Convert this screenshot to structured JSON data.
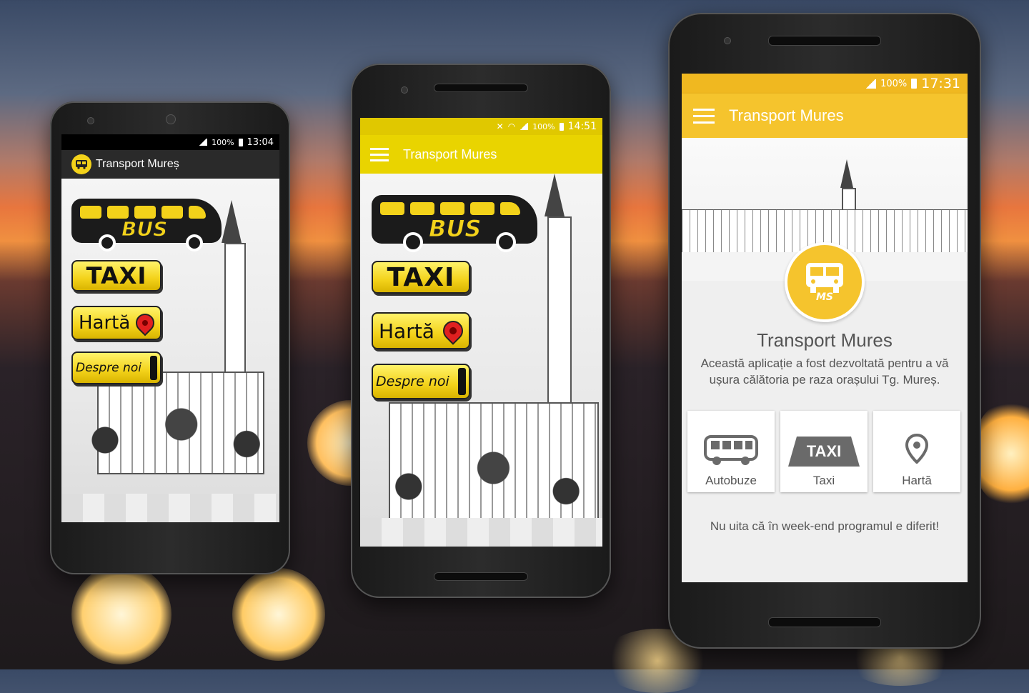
{
  "phone1": {
    "status": {
      "battery": "100%",
      "time": "13:04"
    },
    "app_title": "Transport Mureș",
    "bus_word": "BUS",
    "taxi_label": "TAXI",
    "map_label": "Hartă",
    "about_label": "Despre noi"
  },
  "phone2": {
    "status": {
      "battery": "100%",
      "time": "14:51"
    },
    "app_title": "Transport Mures",
    "bus_word": "BUS",
    "taxi_label": "TAXI",
    "map_label": "Hartă",
    "about_label": "Despre noi"
  },
  "phone3": {
    "status": {
      "battery": "100%",
      "time": "17:31"
    },
    "app_title": "Transport Mures",
    "logo_text": "MS",
    "heading": "Transport Mures",
    "description": "Această aplicație a fost dezvoltată pentru a vă ușura călătoria pe raza orașului Tg. Mureș.",
    "cards": [
      {
        "label": "Autobuze",
        "icon": "bus-icon"
      },
      {
        "label": "Taxi",
        "icon": "taxi-icon",
        "icon_text": "TAXI"
      },
      {
        "label": "Hartă",
        "icon": "map-pin-icon"
      }
    ],
    "footer_note": "Nu uita că în week-end programul e diferit!"
  },
  "colors": {
    "yellow_bar": "#F5C42D",
    "yellow_bar_alt": "#E9D400",
    "old_button_yellow": "#F3D21A",
    "dark_bar": "#212121"
  }
}
